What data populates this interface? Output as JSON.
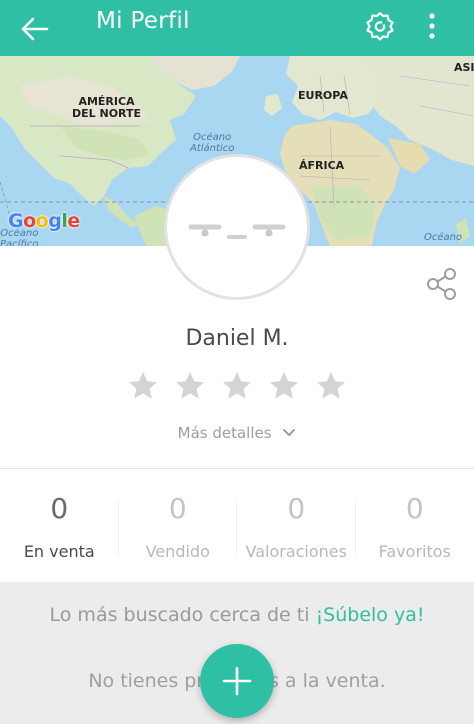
{
  "appbar": {
    "title": "Mi Perfil",
    "back_icon": "arrow-left-icon",
    "settings_icon": "settings-icon",
    "more_icon": "more-vertical-icon"
  },
  "map": {
    "labels": {
      "north_america": "AMÉRICA\nDEL NORTE",
      "europe": "EUROPA",
      "africa": "ÁFRICA",
      "asia": "ASI",
      "atlantic": "Océano\nAtlántico",
      "pacific": "Océano\nPacífico",
      "ocean_right": "Océano"
    },
    "logo": "Google"
  },
  "profile": {
    "name": "Daniel M.",
    "rating": 0,
    "max_rating": 5,
    "more_details": "Más detalles",
    "share_icon": "share-icon"
  },
  "stats": [
    {
      "value": "0",
      "label": "En venta"
    },
    {
      "value": "0",
      "label": "Vendido"
    },
    {
      "value": "0",
      "label": "Valoraciones"
    },
    {
      "value": "0",
      "label": "Favoritos"
    }
  ],
  "bottom": {
    "promo_text": "Lo más buscado cerca de ti",
    "promo_link": "¡Súbelo ya!",
    "empty_text": "No tienes productos a la venta."
  },
  "colors": {
    "accent": "#2ebfa5",
    "background": "#ececec"
  }
}
